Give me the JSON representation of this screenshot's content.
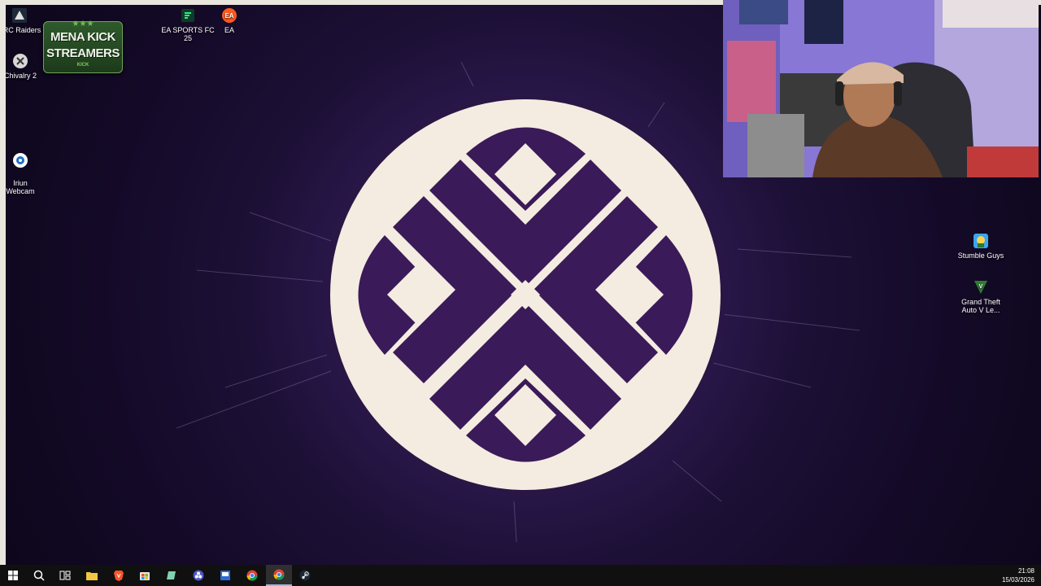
{
  "desktop_icons": {
    "arc_raiders": "ARC Raiders",
    "chivalry": "Chivalry 2",
    "iriun": "Iriun\nWebcam",
    "ea_fc": "EA SPORTS FC 25",
    "ea": "EA",
    "stumble": "Stumble Guys",
    "gta": "Grand Theft Auto V Le..."
  },
  "badge": {
    "stars": "★★★",
    "line1": "MENA KICK",
    "line2": "STREAMERS",
    "sub": "KICK"
  },
  "taskbar": {
    "time": "21:08",
    "date": "15/03/2026",
    "apps": [
      "start-icon",
      "search-icon",
      "task-view-icon",
      "file-explorer-icon",
      "brave-icon",
      "store-icon",
      "notes-icon",
      "obs-icon",
      "terminal-icon",
      "chrome-icon",
      "chrome-profile-icon",
      "steam-icon"
    ]
  },
  "colors": {
    "wallpaper_dark": "#140a28",
    "logo_cream": "#f4ece1",
    "logo_purple": "#3a1a58",
    "taskbar": "#101010"
  }
}
